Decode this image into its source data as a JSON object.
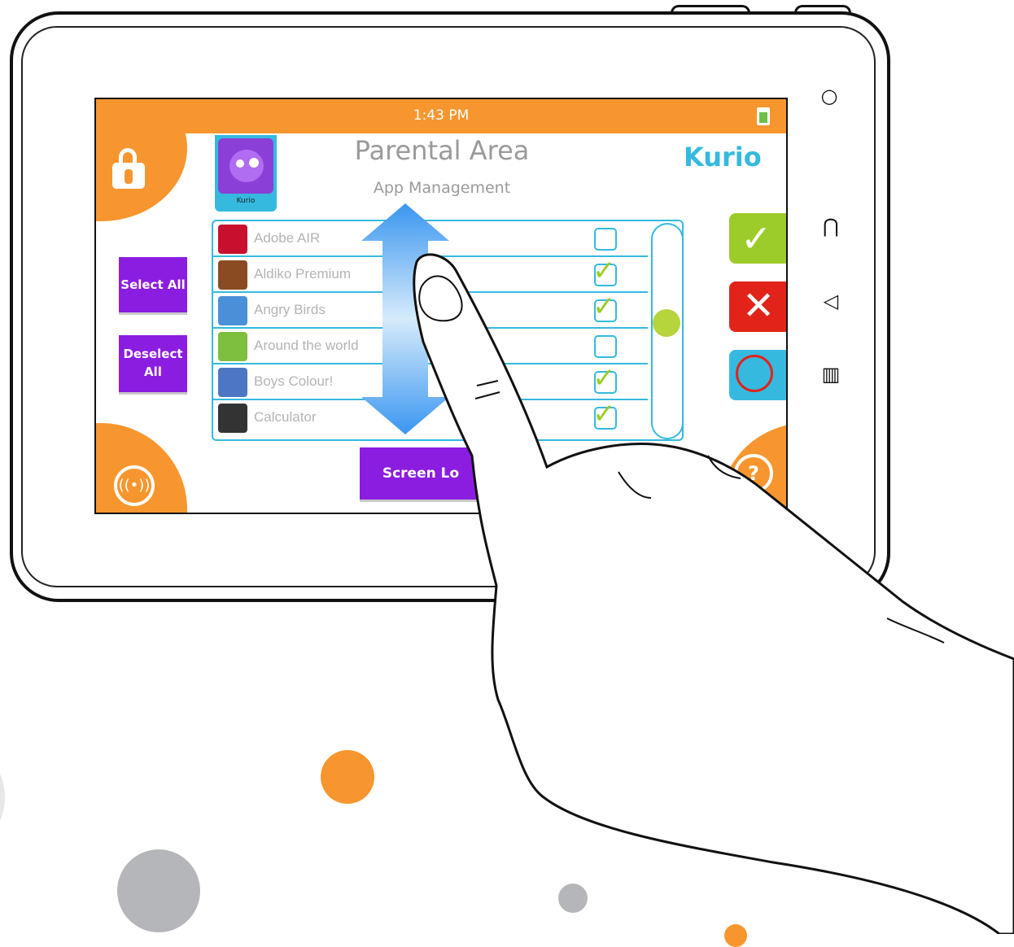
{
  "status_bar": {
    "time": "1:43 PM"
  },
  "header": {
    "title": "Parental Area",
    "subtitle": "App Management",
    "brand": "Kurio"
  },
  "profile": {
    "name": "Kurio"
  },
  "buttons": {
    "select_all": "Select All",
    "deselect_all": "Deselect All",
    "screen_lock": "Screen Lo"
  },
  "apps": [
    {
      "label": "Adobe AIR",
      "checked": false,
      "icon": "adobe-air-icon",
      "color": "#c8102e"
    },
    {
      "label": "Aldiko Premium",
      "checked": true,
      "icon": "books-icon",
      "color": "#8a4b22"
    },
    {
      "label": "Angry Birds",
      "checked": true,
      "icon": "angry-bird-icon",
      "color": "#4a90d9"
    },
    {
      "label": "Around the world",
      "checked": false,
      "icon": "globe-icon",
      "color": "#7fbf3f"
    },
    {
      "label": "Boys Colour!",
      "checked": true,
      "icon": "paint-icon",
      "color": "#4d77c4"
    },
    {
      "label": "Calculator",
      "checked": true,
      "icon": "calculator-icon",
      "color": "#333333"
    }
  ],
  "colors": {
    "orange": "#f7962e",
    "purple": "#8b1de0",
    "blue": "#35b9df",
    "green": "#9ccc2a",
    "red": "#e2231a"
  }
}
